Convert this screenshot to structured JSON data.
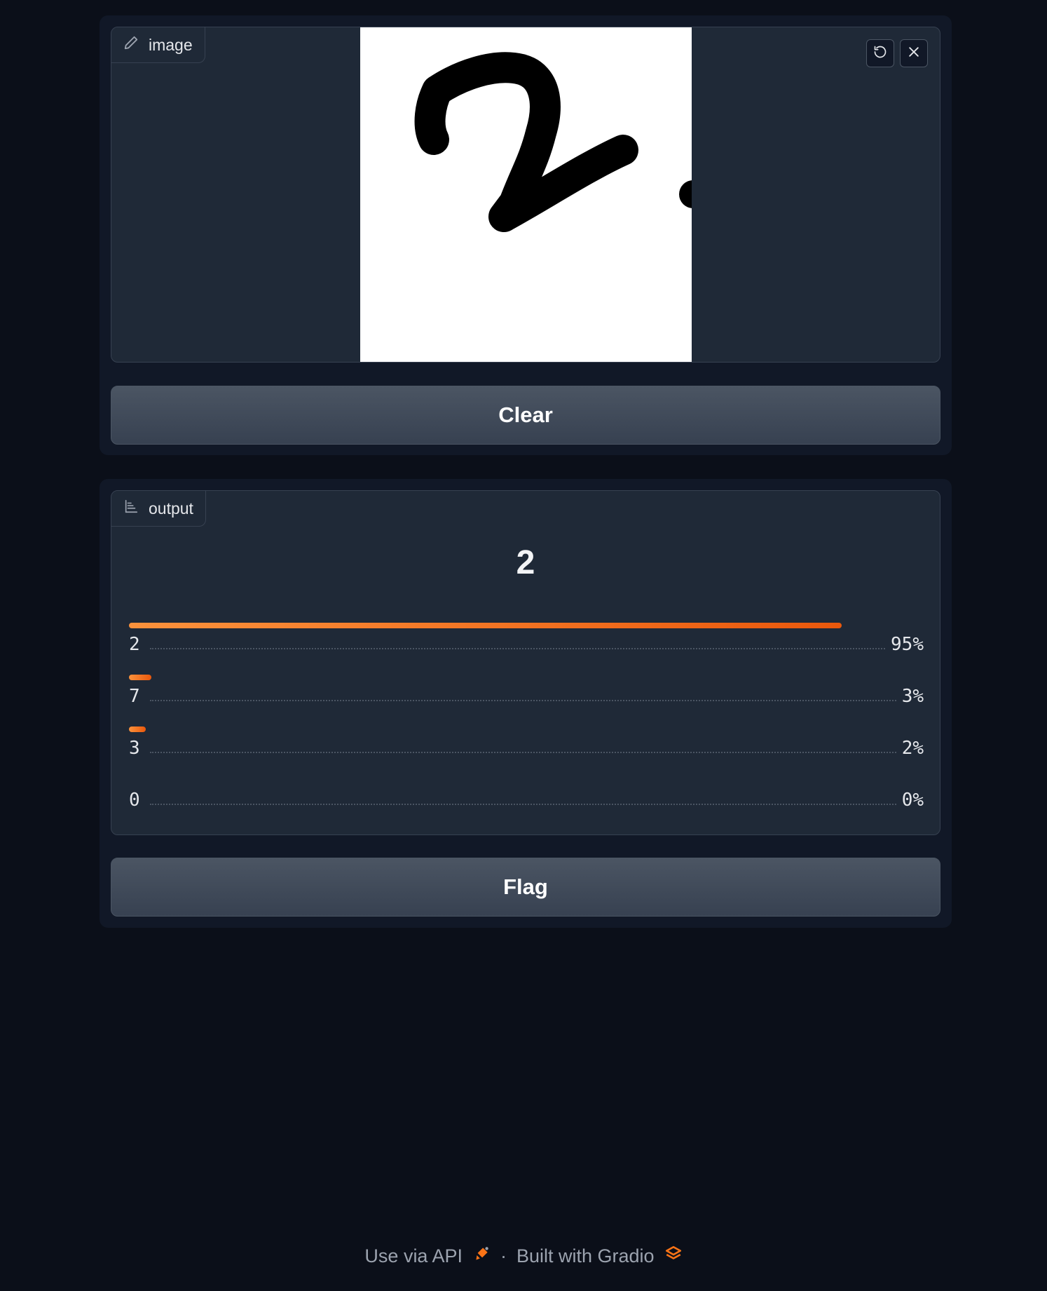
{
  "input": {
    "label": "image",
    "label_icon": "pencil-icon",
    "undo_icon": "undo-icon",
    "close_icon": "close-icon",
    "clear_label": "Clear"
  },
  "output": {
    "label": "output",
    "label_icon": "bar-chart-icon",
    "predicted": "2",
    "confidences": [
      {
        "label": "2",
        "percent_text": "95%",
        "value": 0.95
      },
      {
        "label": "7",
        "percent_text": "3%",
        "value": 0.03
      },
      {
        "label": "3",
        "percent_text": "2%",
        "value": 0.02
      },
      {
        "label": "0",
        "percent_text": "0%",
        "value": 0.0
      }
    ],
    "flag_label": "Flag"
  },
  "footer": {
    "api_label": "Use via API",
    "separator": "·",
    "built_label": "Built with Gradio"
  },
  "colors": {
    "accent": "#f97316",
    "background": "#0b0f19",
    "panel": "#111827",
    "block": "#1f2937"
  }
}
